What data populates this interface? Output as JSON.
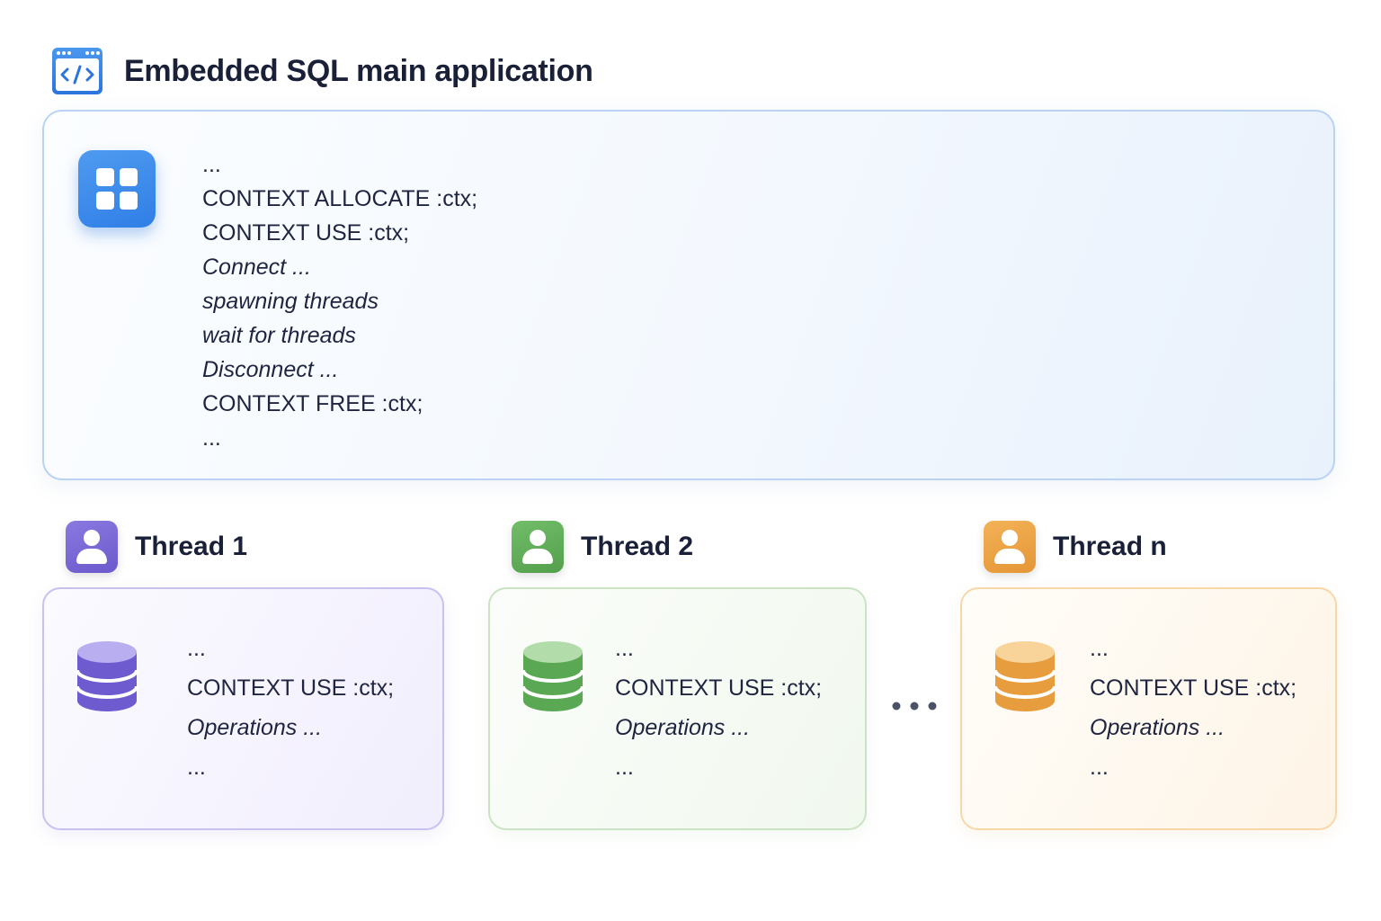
{
  "header": {
    "title": "Embedded SQL main application",
    "icon": "code-window-icon"
  },
  "main": {
    "icon": "grid-icon",
    "lines": [
      {
        "text": "...",
        "italic": false
      },
      {
        "text": "CONTEXT ALLOCATE :ctx;",
        "italic": false
      },
      {
        "text": "CONTEXT USE :ctx;",
        "italic": false
      },
      {
        "text": "Connect ...",
        "italic": true
      },
      {
        "text": "spawning threads",
        "italic": true
      },
      {
        "text": "wait for threads",
        "italic": true
      },
      {
        "text": "Disconnect ...",
        "italic": true
      },
      {
        "text": "CONTEXT FREE :ctx;",
        "italic": false
      },
      {
        "text": "...",
        "italic": false
      }
    ]
  },
  "threads": [
    {
      "title": "Thread 1",
      "icon": "person-icon",
      "db_icon": "database-icon",
      "color": "#7b69d6",
      "lines": [
        "...",
        "CONTEXT USE :ctx;",
        "Operations ...",
        "..."
      ]
    },
    {
      "title": "Thread 2",
      "icon": "person-icon",
      "db_icon": "database-icon",
      "color": "#5fae58",
      "lines": [
        "...",
        "CONTEXT USE :ctx;",
        "Operations ...",
        "..."
      ]
    },
    {
      "title": "Thread n",
      "icon": "person-icon",
      "db_icon": "database-icon",
      "color": "#eda547",
      "lines": [
        "...",
        "CONTEXT USE :ctx;",
        "Operations ...",
        "..."
      ]
    }
  ],
  "between_threads_icon": "ellipsis-dots-icon"
}
